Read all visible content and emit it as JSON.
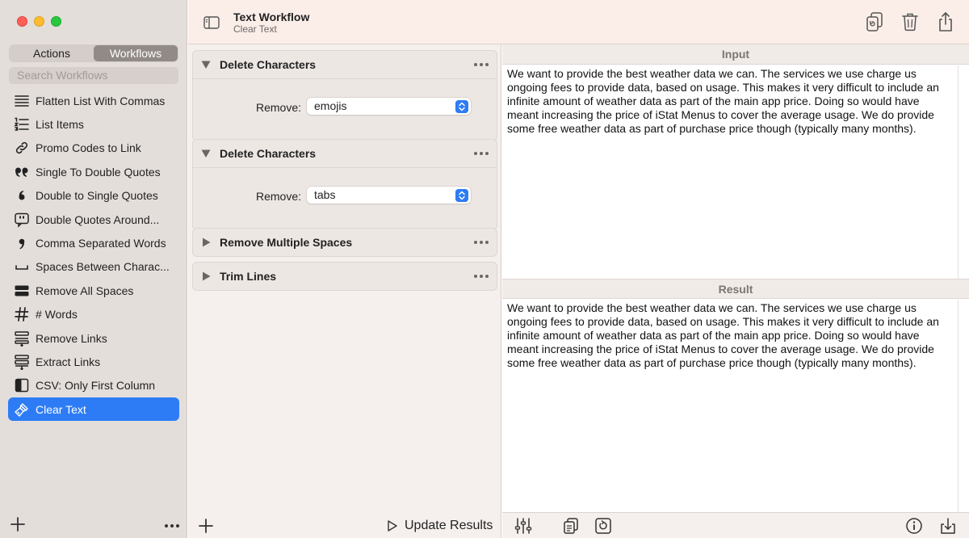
{
  "window": {
    "title": "Text Workflow",
    "subtitle": "Clear Text"
  },
  "sidebar": {
    "segments": [
      {
        "label": "Actions",
        "active": false
      },
      {
        "label": "Workflows",
        "active": true
      }
    ],
    "search_placeholder": "Search Workflows",
    "items": [
      {
        "label": "Flatten List With Commas",
        "icon": "list-flatten-icon"
      },
      {
        "label": "List Items",
        "icon": "numbered-list-icon"
      },
      {
        "label": "Promo Codes to Link",
        "icon": "link-icon"
      },
      {
        "label": "Single To Double Quotes",
        "icon": "double-quote-icon"
      },
      {
        "label": "Double to Single Quotes",
        "icon": "single-quote-icon"
      },
      {
        "label": "Double Quotes Around...",
        "icon": "quote-bubble-icon"
      },
      {
        "label": "Comma Separated Words",
        "icon": "comma-icon"
      },
      {
        "label": "Spaces Between Charac...",
        "icon": "space-icon"
      },
      {
        "label": "Remove All Spaces",
        "icon": "remove-spaces-icon"
      },
      {
        "label": "# Words",
        "icon": "hash-icon"
      },
      {
        "label": "Remove Links",
        "icon": "remove-links-icon"
      },
      {
        "label": "Extract Links",
        "icon": "extract-links-icon"
      },
      {
        "label": "CSV: Only First Column",
        "icon": "column-icon"
      },
      {
        "label": "Clear Text",
        "icon": "brush-icon",
        "selected": true
      }
    ]
  },
  "workflow": {
    "steps": [
      {
        "title": "Delete Characters",
        "expanded": true,
        "field_label": "Remove:",
        "value": "emojis"
      },
      {
        "title": "Delete Characters",
        "expanded": true,
        "field_label": "Remove:",
        "value": "tabs"
      },
      {
        "title": "Remove Multiple Spaces",
        "expanded": false
      },
      {
        "title": "Trim Lines",
        "expanded": false
      }
    ],
    "update_label": "Update Results"
  },
  "panes": {
    "input_header": "Input",
    "input_lines": [
      "We want to provide the best weather data we can. The services we use charge us",
      "ongoing fees to provide data, based on usage. This makes it very difficult to include an",
      "infinite amount of weather data as part of the main app price. Doing so would have",
      "meant increasing the price of iStat Menus to cover the average usage. We do provide",
      "some free weather data as part of purchase price though (typically many months)."
    ],
    "result_header": "Result",
    "result_lines": [
      "We want to provide the best weather data we can. The services we use charge us",
      "ongoing fees to provide data, based on usage. This makes it very difficult to include an",
      "infinite amount of weather data as part of the main app price. Doing so would have",
      "meant increasing the price of iStat Menus to cover the average usage. We do provide",
      "some free weather data as part of purchase price though (typically many months)."
    ]
  },
  "colors": {
    "accent": "#2d7cf6",
    "sidebar_bg": "#e4dedb",
    "toolbar_bg": "#fbeee9"
  }
}
